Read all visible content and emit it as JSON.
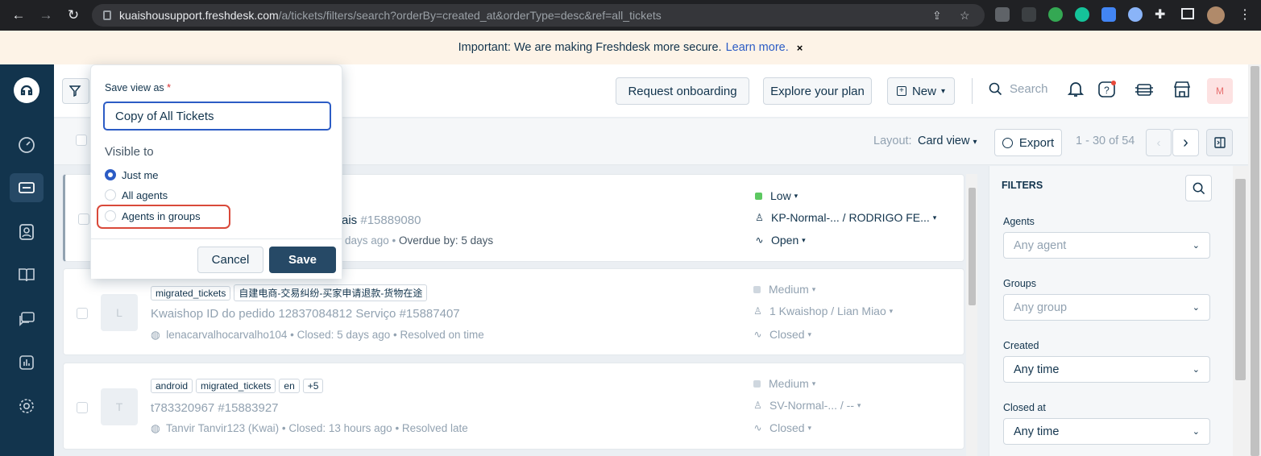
{
  "browser": {
    "url_host": "kuaishousupport.freshdesk.com",
    "url_path": "/a/tickets/filters/search?orderBy=created_at&orderType=desc&ref=all_tickets"
  },
  "banner": {
    "text": "Important: We are making Freshdesk more secure.",
    "link": "Learn more.",
    "close": "×"
  },
  "header": {
    "request_onboarding": "Request onboarding",
    "explore_plan": "Explore your plan",
    "new_label": "New",
    "search_placeholder": "Search",
    "avatar_initial": "M"
  },
  "toolbar": {
    "layout_label": "Layout:",
    "layout_value": "Card view",
    "export_label": "Export",
    "pagination": "1 - 30 of 54"
  },
  "save_view": {
    "label": "Save view as",
    "required_mark": "*",
    "input_value": "Copy of All Tickets",
    "visible_to": "Visible to",
    "options": [
      "Just me",
      "All agents",
      "Agents in groups"
    ],
    "selected": "Just me",
    "cancel": "Cancel",
    "save": "Save"
  },
  "tickets": [
    {
      "subject_tail": "ais",
      "number": "#15889080",
      "meta_tail": "days ago",
      "meta_extra": "Overdue by: 5 days",
      "priority": "Low",
      "priority_color": "#5dc861",
      "assignee": "KP-Normal-... / RODRIGO FE...",
      "status": "Open"
    },
    {
      "tags": [
        "migrated_tickets",
        "自建电商-交易纠纷-买家申请退款-货物在途"
      ],
      "avatar": "L",
      "subject": "Kwaishop ID do pedido 12837084812 Serviço",
      "number": "#15887407",
      "requester": "lenacarvalhocarvalho104",
      "closed": "Closed: 5 days ago",
      "resolution": "Resolved on time",
      "priority": "Medium",
      "assignee": "1 Kwaishop / Lian Miao",
      "status": "Closed"
    },
    {
      "tags": [
        "android",
        "migrated_tickets",
        "en",
        "+5"
      ],
      "avatar": "T",
      "subject": "t783320967",
      "number": "#15883927",
      "requester": "Tanvir Tanvir123 (Kwai)",
      "closed": "Closed: 13 hours ago",
      "resolution": "Resolved late",
      "priority": "Medium",
      "assignee": "SV-Normal-... / --",
      "status": "Closed"
    }
  ],
  "filters": {
    "title": "FILTERS",
    "agents_label": "Agents",
    "agents_placeholder": "Any agent",
    "groups_label": "Groups",
    "groups_placeholder": "Any group",
    "created_label": "Created",
    "created_value": "Any time",
    "closed_label": "Closed at",
    "closed_value": "Any time"
  }
}
